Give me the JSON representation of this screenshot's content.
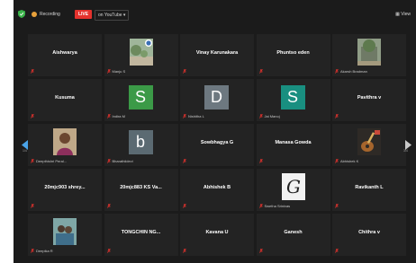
{
  "topbar": {
    "recording_label": "Recording",
    "live_label": "LIVE",
    "youtube_label": "on YouTube",
    "view_label": "View"
  },
  "nav": {
    "left_page": "1/4",
    "right_page": "3/4"
  },
  "colors": {
    "background": "#1b1b1b",
    "tile": "#232323",
    "live": "#e5322d",
    "recording": "#e8a13b",
    "mic_muted": "#e5322d"
  },
  "tiles": [
    {
      "name": "Aishwarya",
      "caption": ""
    },
    {
      "name": "",
      "caption": "Manju S",
      "image": "park-photo"
    },
    {
      "name": "Vinay Karunakara",
      "caption": ""
    },
    {
      "name": "Phuntso eden",
      "caption": ""
    },
    {
      "name": "",
      "caption": "Akarsh Bradman",
      "image": "building-photo"
    },
    {
      "name": "Kusuma",
      "caption": ""
    },
    {
      "name": "",
      "caption": "Indira M",
      "avatar_letter": "S",
      "avatar_color": "#3b9a47"
    },
    {
      "name": "",
      "caption": "Nishitha L",
      "avatar_letter": "D",
      "avatar_color": "#6d7880"
    },
    {
      "name": "",
      "caption": "Jai Manoj",
      "avatar_letter": "S",
      "avatar_color": "#198f80"
    },
    {
      "name": "Pavithra v",
      "caption": ""
    },
    {
      "name": "",
      "caption": "Deepthishri Peral...",
      "image": "person-photo"
    },
    {
      "name": "",
      "caption": "Bharathiidevi",
      "avatar_letter": "b",
      "avatar_color": "#5b6a72"
    },
    {
      "name": "Sowbhagya G",
      "caption": ""
    },
    {
      "name": "Manasa Gowda",
      "caption": ""
    },
    {
      "name": "",
      "caption": "Abhishek K",
      "image": "guitar-photo"
    },
    {
      "name": "20mjc903 shrey...",
      "caption": ""
    },
    {
      "name": "20mjc883 KS Va...",
      "caption": ""
    },
    {
      "name": "Abhishek B",
      "caption": ""
    },
    {
      "name": "",
      "caption": "Swetha Srinivas",
      "image": "letter-g-image"
    },
    {
      "name": "Ravikanth L",
      "caption": ""
    },
    {
      "name": "",
      "caption": "Deepika R",
      "image": "group-photo"
    },
    {
      "name": "TONGCHIN NG...",
      "caption": ""
    },
    {
      "name": "Kavana U",
      "caption": ""
    },
    {
      "name": "Ganesh",
      "caption": ""
    },
    {
      "name": "Chithra v",
      "caption": ""
    }
  ]
}
